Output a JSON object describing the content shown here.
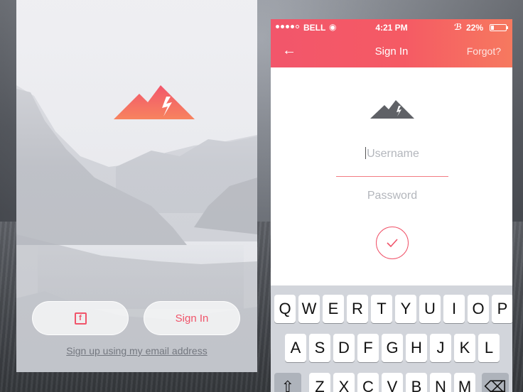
{
  "left_screen": {
    "signin_label": "Sign In",
    "facebook_icon": "f",
    "signup_link": "Sign up using my email address",
    "logo_icon": "mountain-logo-icon"
  },
  "status_bar": {
    "carrier": "BELL",
    "time": "4:21 PM",
    "battery": "22%",
    "battery_level": 0.22
  },
  "nav": {
    "back_icon": "←",
    "title": "Sign In",
    "forgot": "Forgot?"
  },
  "form": {
    "username_placeholder": "Username",
    "password_placeholder": "Password",
    "submit_icon": "checkmark-icon"
  },
  "keyboard": {
    "row1": [
      "Q",
      "W",
      "E",
      "R",
      "T",
      "Y",
      "U",
      "I",
      "O",
      "P"
    ],
    "row2": [
      "A",
      "S",
      "D",
      "F",
      "G",
      "H",
      "J",
      "K",
      "L"
    ],
    "row3": [
      "Z",
      "X",
      "C",
      "V",
      "B",
      "N",
      "M"
    ],
    "shift_icon": "⇧",
    "backspace_icon": "⌫"
  },
  "colors": {
    "accent": "#f0546a",
    "header_start": "#f2566b",
    "header_end": "#f6795f"
  }
}
